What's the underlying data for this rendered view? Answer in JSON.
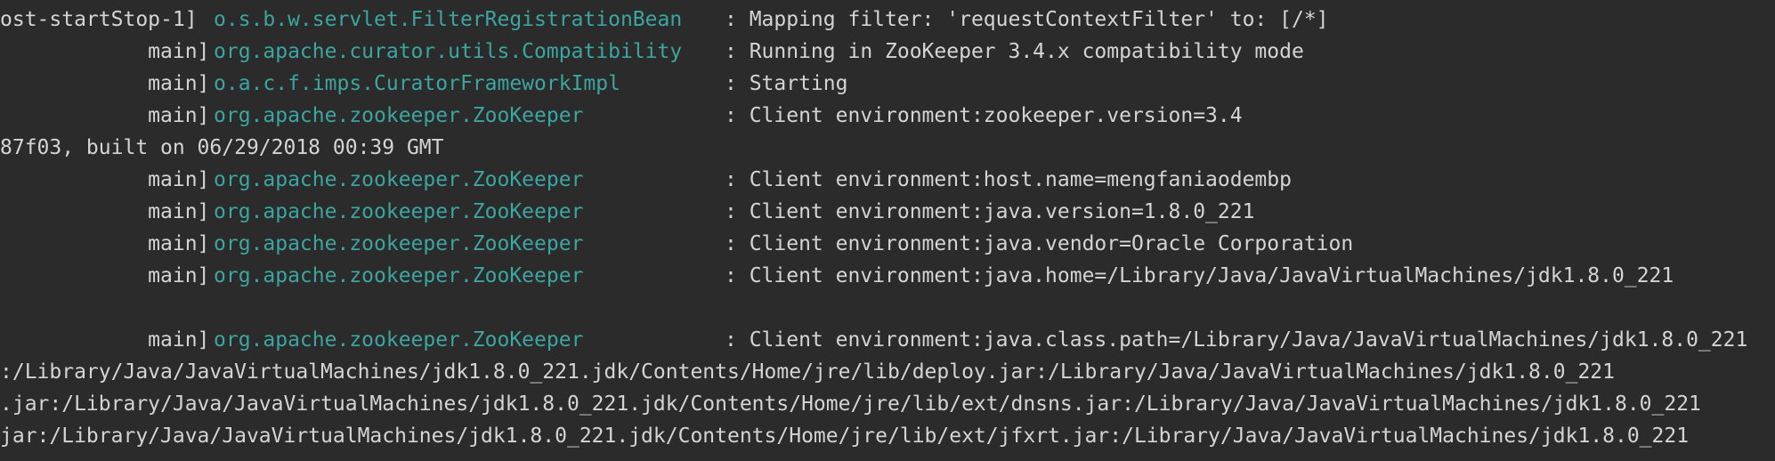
{
  "console": {
    "lines": [
      {
        "thread": "ost-startStop-1]",
        "logger": "o.s.b.w.servlet.FilterRegistrationBean",
        "message": ": Mapping filter: 'requestContextFilter' to: [/*]"
      },
      {
        "thread": "            main]",
        "logger": "org.apache.curator.utils.Compatibility",
        "message": ": Running in ZooKeeper 3.4.x compatibility mode"
      },
      {
        "thread": "            main]",
        "logger": "o.a.c.f.imps.CuratorFrameworkImpl",
        "message": ": Starting"
      },
      {
        "thread": "            main]",
        "logger": "org.apache.zookeeper.ZooKeeper",
        "message": ": Client environment:zookeeper.version=3.4"
      },
      {
        "text": "87f03, built on 06/29/2018 00:39 GMT"
      },
      {
        "thread": "            main]",
        "logger": "org.apache.zookeeper.ZooKeeper",
        "message": ": Client environment:host.name=mengfaniaodembp"
      },
      {
        "thread": "            main]",
        "logger": "org.apache.zookeeper.ZooKeeper",
        "message": ": Client environment:java.version=1.8.0_221"
      },
      {
        "thread": "            main]",
        "logger": "org.apache.zookeeper.ZooKeeper",
        "message": ": Client environment:java.vendor=Oracle Corporation"
      },
      {
        "thread": "            main]",
        "logger": "org.apache.zookeeper.ZooKeeper",
        "message": ": Client environment:java.home=/Library/Java/JavaVirtualMachines/jdk1.8.0_221"
      },
      {
        "text": ""
      },
      {
        "thread": "            main]",
        "logger": "org.apache.zookeeper.ZooKeeper",
        "message": ": Client environment:java.class.path=/Library/Java/JavaVirtualMachines/jdk1.8.0_221"
      },
      {
        "text": ":/Library/Java/JavaVirtualMachines/jdk1.8.0_221.jdk/Contents/Home/jre/lib/deploy.jar:/Library/Java/JavaVirtualMachines/jdk1.8.0_221"
      },
      {
        "text": ".jar:/Library/Java/JavaVirtualMachines/jdk1.8.0_221.jdk/Contents/Home/jre/lib/ext/dnsns.jar:/Library/Java/JavaVirtualMachines/jdk1.8.0_221"
      },
      {
        "text": "jar:/Library/Java/JavaVirtualMachines/jdk1.8.0_221.jdk/Contents/Home/jre/lib/ext/jfxrt.jar:/Library/Java/JavaVirtualMachines/jdk1.8.0_221"
      }
    ]
  },
  "colors": {
    "background": "#2b2b2b",
    "text": "#d4d4d4",
    "logger": "#3aa6a0"
  }
}
